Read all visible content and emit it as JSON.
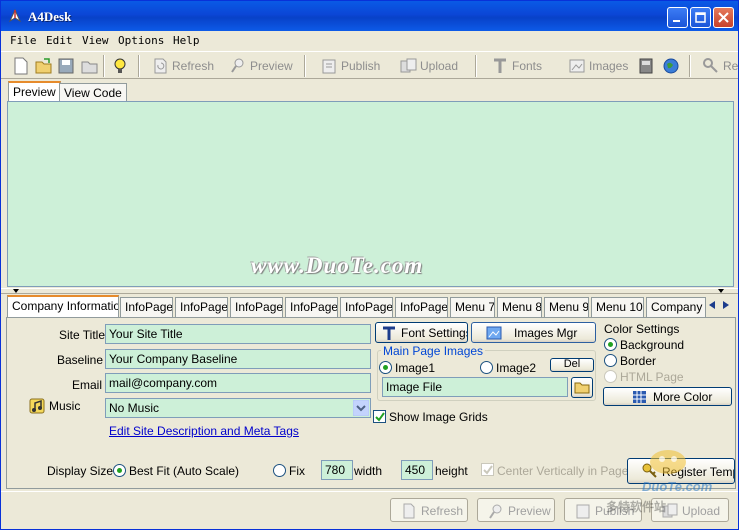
{
  "window": {
    "title": "A4Desk"
  },
  "menubar": {
    "items": [
      "File",
      "Edit",
      "View",
      "Options",
      "Help"
    ]
  },
  "toolbar": {
    "refresh": "Refresh",
    "preview": "Preview",
    "publish": "Publish",
    "upload": "Upload",
    "fonts": "Fonts",
    "images": "Images",
    "register": "Re"
  },
  "view_tabs": {
    "preview": "Preview",
    "code": "View Code"
  },
  "watermark": "www.DuoTe.com",
  "page_tabs": [
    "Company Information",
    "InfoPage",
    "InfoPage",
    "InfoPage",
    "InfoPage",
    "InfoPage",
    "InfoPage",
    "Menu 7",
    "Menu 8",
    "Menu 9",
    "Menu 10",
    "Company I"
  ],
  "company": {
    "site_title_label": "Site Title",
    "site_title_value": "Your Site Title",
    "baseline_label": "Baseline",
    "baseline_value": "Your Company Baseline",
    "email_label": "Email",
    "email_value": "mail@company.com",
    "music_label": "Music",
    "music_value": "No Music",
    "edit_meta_link": "Edit Site Description and Meta Tags"
  },
  "buttons": {
    "font_settings": "Font Settings",
    "images_mgr": "Images Mgr",
    "del": "Del",
    "more_color": "More Color",
    "register": "Register Templ"
  },
  "main_images": {
    "title": "Main Page Images",
    "image1": "Image1",
    "image2": "Image2",
    "image_file": "Image File",
    "show_grids": "Show Image Grids",
    "selected": "Image1"
  },
  "color_settings": {
    "title": "Color Settings",
    "background": "Background",
    "border": "Border",
    "html_page": "HTML Page",
    "selected": "Background"
  },
  "display": {
    "label": "Display Size",
    "best_fit": "Best Fit (Auto Scale)",
    "fix": "Fix",
    "width_value": "780",
    "width_label": "width",
    "height_value": "450",
    "height_label": "height",
    "center_vert": "Center Vertically in Page",
    "selected": "Best Fit (Auto Scale)"
  },
  "footer": {
    "refresh": "Refresh",
    "preview": "Preview",
    "publish": "Publish",
    "upload": "Upload"
  },
  "corner_watermark": {
    "line1": "DuoTe.com",
    "line2": "多特软件站"
  }
}
